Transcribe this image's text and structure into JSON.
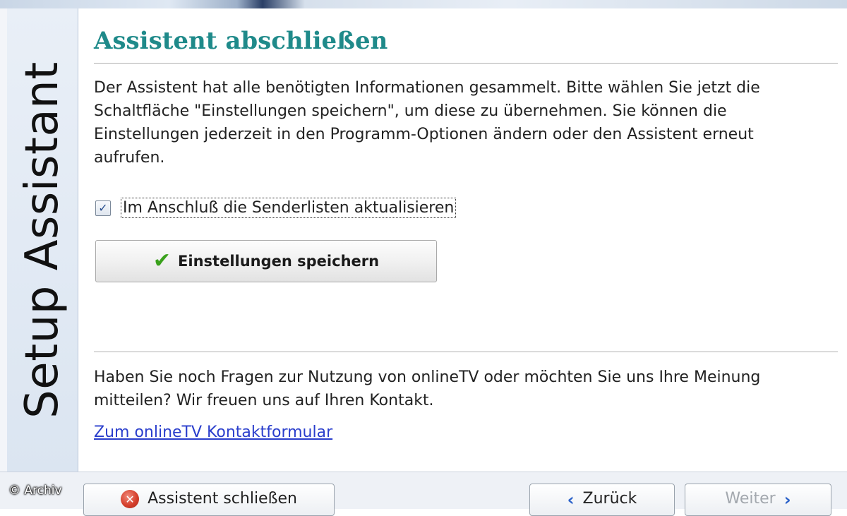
{
  "sidebar": {
    "title": "Setup Assistant"
  },
  "page": {
    "title": "Assistent abschließen",
    "intro": "Der Assistent hat alle benötigten Informationen gesammelt. Bitte wählen Sie jetzt die Schaltfläche \"Einstellungen speichern\", um diese zu übernehmen. Sie können die Einstellungen jederzeit in den Programm-Optionen ändern oder den Assistent erneut aufrufen.",
    "checkbox_label": "Im Anschluß die Senderlisten aktualisieren",
    "checkbox_checked": true,
    "save_button_label": "Einstellungen speichern",
    "outro": "Haben Sie noch Fragen zur Nutzung von onlineTV oder möchten Sie uns Ihre Meinung mitteilen? Wir freuen uns auf Ihren Kontakt.",
    "contact_link": "Zum onlineTV Kontaktformular"
  },
  "footer": {
    "copyright": "© Archiv",
    "close_label": "Assistent schließen",
    "back_label": "Zurück",
    "next_label": "Weiter"
  },
  "icons": {
    "checkbox_mark": "check-mark-icon",
    "save": "green-check-icon",
    "close": "close-icon",
    "back": "chevron-left-icon",
    "next": "chevron-right-icon"
  },
  "colors": {
    "title": "#1f8a8a",
    "link": "#2a3ecc",
    "save_check": "#3aa11c",
    "close_icon": "#d6402d",
    "nav_arrow": "#2c62c9"
  }
}
